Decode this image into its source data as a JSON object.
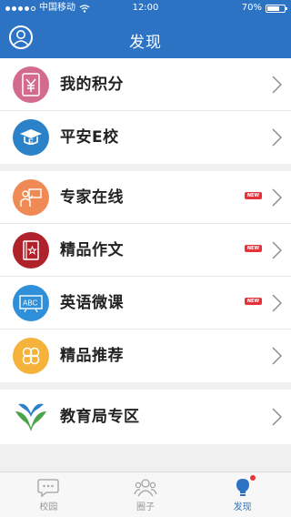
{
  "status_bar": {
    "carrier": "中国移动",
    "time": "12:00",
    "battery": "70%",
    "battery_level": 0.7
  },
  "header": {
    "title": "发现"
  },
  "groups": [
    {
      "items": [
        {
          "label": "我的积分",
          "icon": "yuan-coin-icon",
          "color": "#d36b8e"
        },
        {
          "label": "平安E校",
          "icon": "graduation-cap-icon",
          "color": "#2b82c9"
        }
      ]
    },
    {
      "items": [
        {
          "label": "专家在线",
          "icon": "teacher-board-icon",
          "color": "#f08a55",
          "badge": "NEW"
        },
        {
          "label": "精品作文",
          "icon": "book-star-icon",
          "color": "#b0222b",
          "badge": "NEW"
        },
        {
          "label": "英语微课",
          "icon": "abc-board-icon",
          "color": "#2f8fd8",
          "badge": "NEW"
        },
        {
          "label": "精品推荐",
          "icon": "clover-icon",
          "color": "#f5b33c"
        }
      ]
    },
    {
      "items": [
        {
          "label": "教育局专区",
          "icon": "education-bureau-logo-icon"
        }
      ]
    }
  ],
  "tabbar": {
    "tabs": [
      {
        "label": "校园",
        "icon": "chat-bubble-icon"
      },
      {
        "label": "圈子",
        "icon": "people-icon"
      },
      {
        "label": "发现",
        "icon": "lightbulb-icon",
        "active": true
      }
    ]
  },
  "colors": {
    "primary": "#2c73c4",
    "badge": "#e8323a"
  }
}
